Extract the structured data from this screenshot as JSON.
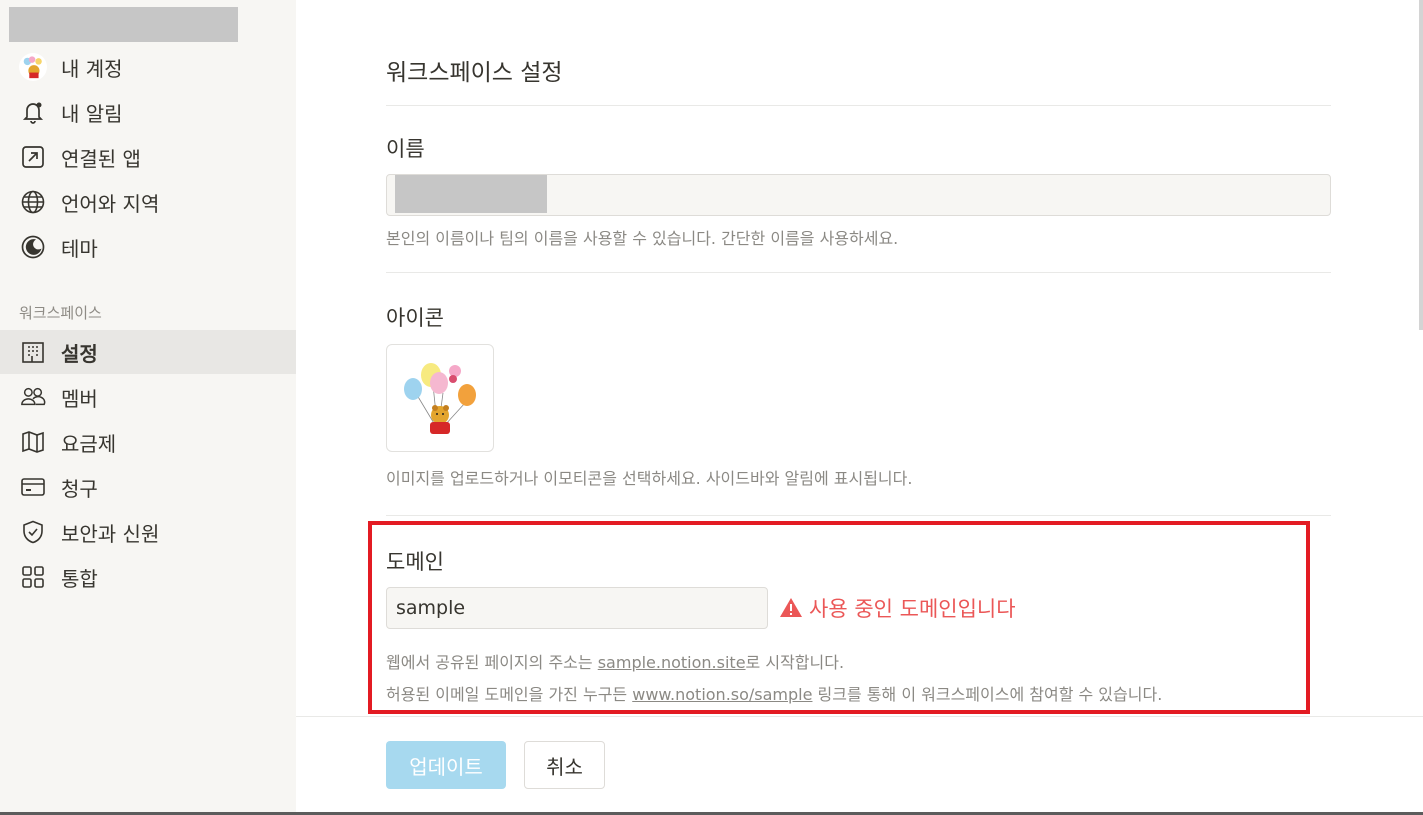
{
  "sidebar": {
    "account_items": [
      {
        "label": "내 계정",
        "icon": "avatar-icon"
      },
      {
        "label": "내 알림",
        "icon": "bell-icon"
      },
      {
        "label": "연결된 앱",
        "icon": "arrow-up-right-square-icon"
      },
      {
        "label": "언어와 지역",
        "icon": "globe-icon"
      },
      {
        "label": "테마",
        "icon": "moon-icon"
      }
    ],
    "workspace_section_label": "워크스페이스",
    "workspace_items": [
      {
        "label": "설정",
        "icon": "building-icon",
        "active": true
      },
      {
        "label": "멤버",
        "icon": "people-icon"
      },
      {
        "label": "요금제",
        "icon": "map-icon"
      },
      {
        "label": "청구",
        "icon": "credit-card-icon"
      },
      {
        "label": "보안과 신원",
        "icon": "shield-check-icon"
      },
      {
        "label": "통합",
        "icon": "grid-icon"
      }
    ]
  },
  "main": {
    "title": "워크스페이스 설정",
    "name": {
      "label": "이름",
      "help": "본인의 이름이나 팀의 이름을 사용할 수 있습니다. 간단한 이름을 사용하세요."
    },
    "icon": {
      "label": "아이콘",
      "help": "이미지를 업로드하거나 이모티콘을 선택하세요. 사이드바와 알림에 표시됩니다."
    },
    "domain": {
      "label": "도메인",
      "value": "sample",
      "error": "사용 중인 도메인입니다",
      "help1_prefix": "웹에서 공유된 페이지의 주소는 ",
      "help1_link": "sample.notion.site",
      "help1_suffix": "로 시작합니다.",
      "help2_prefix": "허용된 이메일 도메인을 가진 누구든 ",
      "help2_link": "www.notion.so/sample",
      "help2_suffix": " 링크를 통해 이 워크스페이스에 참여할 수 있습니다."
    }
  },
  "footer": {
    "update_label": "업데이트",
    "cancel_label": "취소"
  },
  "colors": {
    "error": "#eb5757",
    "highlight": "#e31b23",
    "update_button": "#a7d9ef",
    "sidebar_bg": "#f7f6f3"
  }
}
